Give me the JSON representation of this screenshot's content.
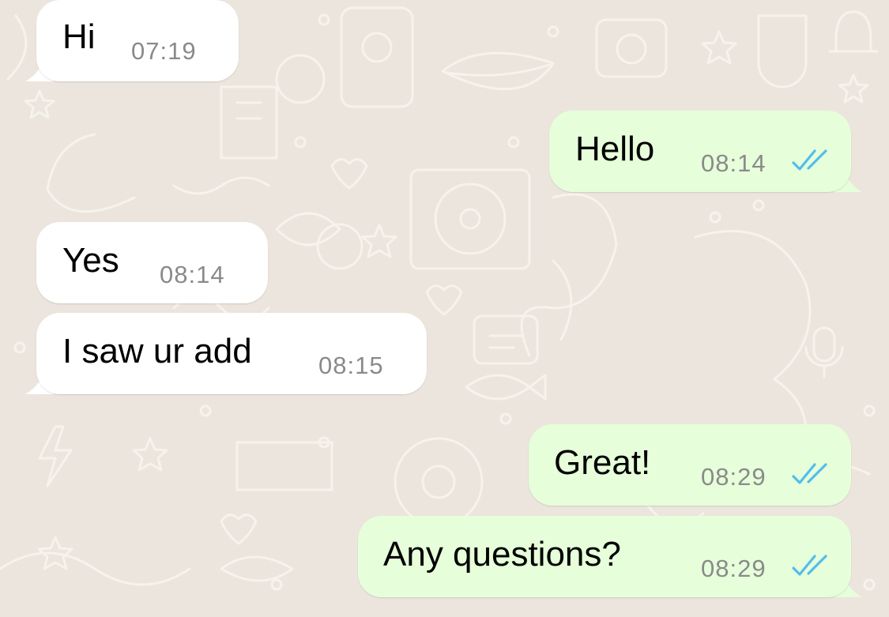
{
  "colors": {
    "background": "#ece5dd",
    "incoming_bubble": "#ffffff",
    "outgoing_bubble": "#e6ffda",
    "timestamp": "#8a8a8a",
    "read_ticks": "#53bdeb"
  },
  "messages": [
    {
      "direction": "incoming",
      "text": "Hi",
      "time": "07:19"
    },
    {
      "direction": "outgoing",
      "text": "Hello",
      "time": "08:14",
      "status": "read"
    },
    {
      "direction": "incoming",
      "text": "Yes",
      "time": "08:14"
    },
    {
      "direction": "incoming",
      "text": "I saw ur add",
      "time": "08:15"
    },
    {
      "direction": "outgoing",
      "text": "Great!",
      "time": "08:29",
      "status": "read"
    },
    {
      "direction": "outgoing",
      "text": "Any questions?",
      "time": "08:29",
      "status": "read"
    }
  ],
  "icons": {
    "read_receipt": "double-check-icon",
    "wallpaper": "chat-doodle-pattern"
  }
}
